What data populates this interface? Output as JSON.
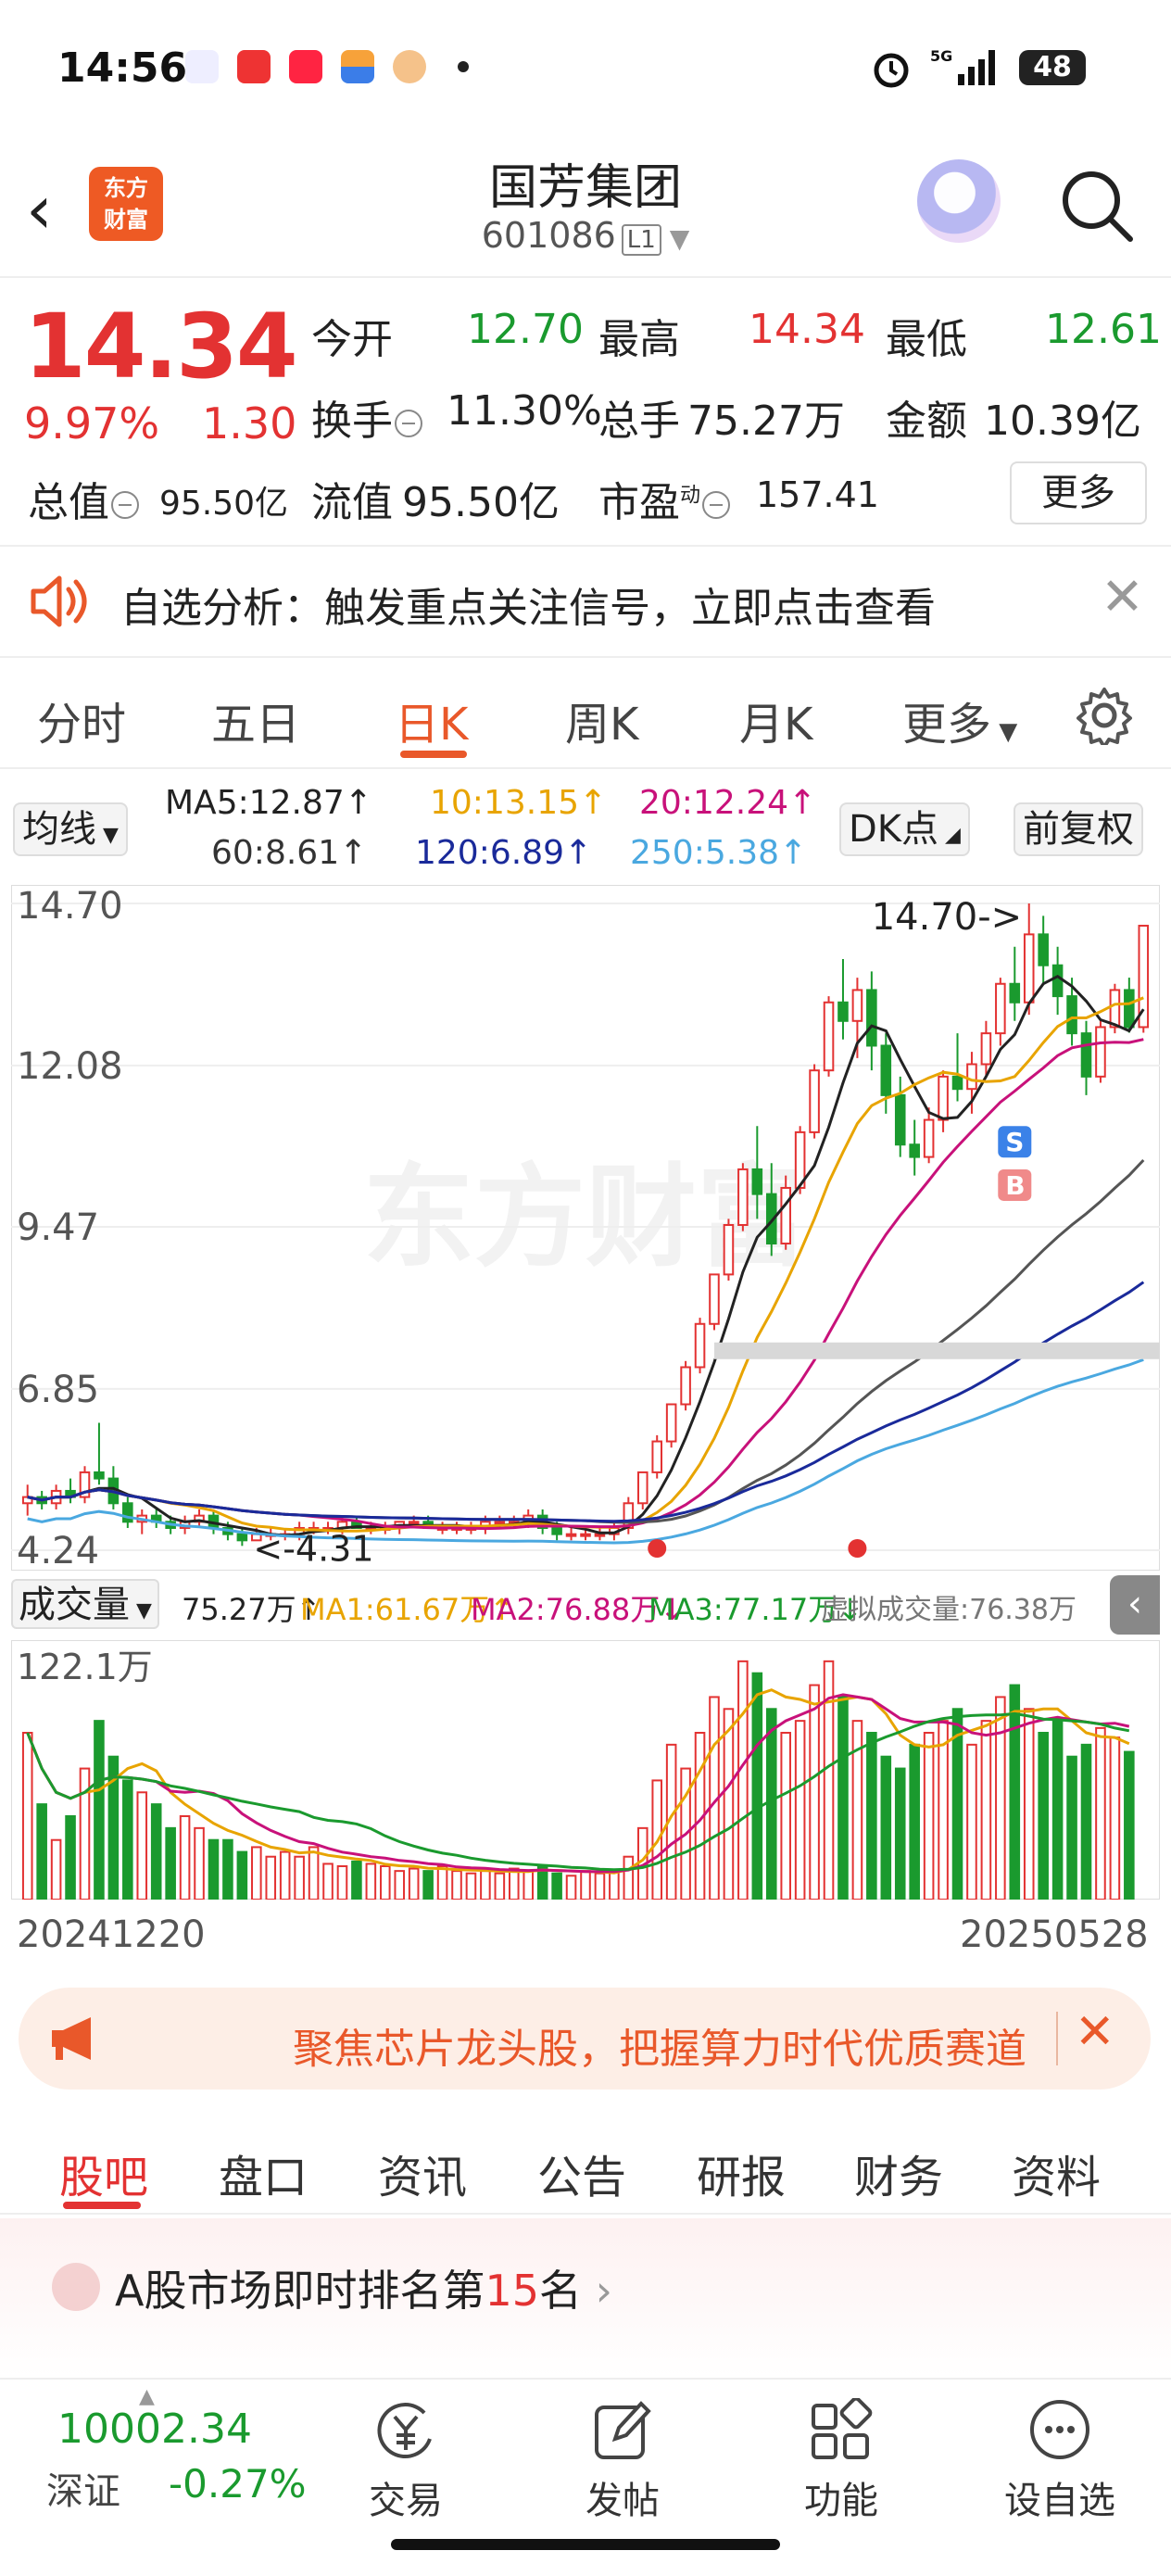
{
  "status": {
    "time": "14:56",
    "battery": "48"
  },
  "header": {
    "title": "国芳集团",
    "code": "601086",
    "level": "L1",
    "brand_line1": "东方",
    "brand_line2": "财富"
  },
  "quote": {
    "price": "14.34",
    "pct": "9.97%",
    "change": "1.30",
    "open_label": "今开",
    "open": "12.70",
    "high_label": "最高",
    "high": "14.34",
    "low_label": "最低",
    "low": "12.61",
    "turnover_label": "换手",
    "turnover": "11.30%",
    "volume_label": "总手",
    "volume": "75.27万",
    "amount_label": "金额",
    "amount": "10.39亿",
    "mktcap_label": "总值",
    "mktcap": "95.50亿",
    "float_label": "流值",
    "float_cap": "95.50亿",
    "pe_label": "市盈",
    "pe_sup": "动",
    "pe": "157.41",
    "more": "更多"
  },
  "alert": {
    "text": "自选分析：触发重点关注信号，立即点击查看"
  },
  "ktabs": [
    "分时",
    "五日",
    "日K",
    "周K",
    "月K",
    "更多"
  ],
  "ma_legend": {
    "selector": "均线",
    "ma5": "MA5:12.87↑",
    "ma10": "10:13.15↑",
    "ma20": "20:12.24↑",
    "ma60": "60:8.61↑",
    "ma120": "120:6.89↑",
    "ma250": "250:5.38↑",
    "dk": "DK点",
    "adjust": "前复权",
    "colors": {
      "ma5": "#222222",
      "ma10": "#e8a400",
      "ma20": "#c8117a",
      "ma60": "#555555",
      "ma120": "#1a2a9a",
      "ma250": "#4aa8e0"
    }
  },
  "chart_data": [
    {
      "type": "candlestick",
      "ylim": [
        4.24,
        14.7
      ],
      "yticks": [
        "14.70",
        "12.08",
        "9.47",
        "6.85",
        "4.24"
      ],
      "x_start": "20241220",
      "x_end": "20250528",
      "max_annotation": "14.70->",
      "min_annotation": "<-4.31",
      "watermark": "东方财富",
      "signals": [
        "S",
        "B"
      ],
      "candles": [
        [
          5.0,
          5.3,
          4.8,
          5.1
        ],
        [
          5.1,
          5.2,
          4.9,
          5.0
        ],
        [
          5.0,
          5.3,
          4.9,
          5.2
        ],
        [
          5.2,
          5.4,
          5.0,
          5.1
        ],
        [
          5.1,
          5.6,
          5.0,
          5.5
        ],
        [
          5.5,
          6.3,
          5.3,
          5.4
        ],
        [
          5.4,
          5.6,
          4.9,
          5.0
        ],
        [
          5.0,
          5.1,
          4.6,
          4.7
        ],
        [
          4.7,
          4.9,
          4.5,
          4.8
        ],
        [
          4.8,
          4.9,
          4.6,
          4.7
        ],
        [
          4.7,
          4.8,
          4.5,
          4.6
        ],
        [
          4.6,
          4.8,
          4.5,
          4.7
        ],
        [
          4.7,
          4.9,
          4.6,
          4.8
        ],
        [
          4.8,
          4.9,
          4.5,
          4.6
        ],
        [
          4.6,
          4.7,
          4.4,
          4.5
        ],
        [
          4.5,
          4.6,
          4.31,
          4.4
        ],
        [
          4.4,
          4.6,
          4.4,
          4.5
        ],
        [
          4.5,
          4.6,
          4.4,
          4.5
        ],
        [
          4.5,
          4.6,
          4.4,
          4.5
        ],
        [
          4.5,
          4.7,
          4.4,
          4.6
        ],
        [
          4.6,
          4.7,
          4.5,
          4.6
        ],
        [
          4.6,
          4.7,
          4.5,
          4.6
        ],
        [
          4.6,
          4.8,
          4.5,
          4.7
        ],
        [
          4.7,
          4.8,
          4.6,
          4.6
        ],
        [
          4.6,
          4.7,
          4.5,
          4.6
        ],
        [
          4.6,
          4.7,
          4.5,
          4.6
        ],
        [
          4.6,
          4.7,
          4.5,
          4.7
        ],
        [
          4.7,
          4.8,
          4.6,
          4.7
        ],
        [
          4.7,
          4.8,
          4.6,
          4.6
        ],
        [
          4.6,
          4.7,
          4.5,
          4.6
        ],
        [
          4.6,
          4.7,
          4.5,
          4.6
        ],
        [
          4.6,
          4.7,
          4.5,
          4.6
        ],
        [
          4.6,
          4.8,
          4.5,
          4.7
        ],
        [
          4.7,
          4.8,
          4.6,
          4.7
        ],
        [
          4.7,
          4.8,
          4.6,
          4.7
        ],
        [
          4.7,
          4.9,
          4.6,
          4.8
        ],
        [
          4.8,
          4.9,
          4.5,
          4.6
        ],
        [
          4.6,
          4.7,
          4.4,
          4.5
        ],
        [
          4.5,
          4.6,
          4.4,
          4.5
        ],
        [
          4.5,
          4.6,
          4.4,
          4.5
        ],
        [
          4.5,
          4.6,
          4.4,
          4.5
        ],
        [
          4.5,
          4.7,
          4.4,
          4.6
        ],
        [
          4.6,
          5.1,
          4.5,
          5.0
        ],
        [
          5.0,
          5.5,
          4.9,
          5.5
        ],
        [
          5.5,
          6.1,
          5.4,
          6.0
        ],
        [
          6.0,
          6.6,
          5.9,
          6.6
        ],
        [
          6.6,
          7.3,
          6.5,
          7.2
        ],
        [
          7.2,
          8.0,
          7.1,
          7.9
        ],
        [
          7.9,
          8.7,
          7.8,
          8.7
        ],
        [
          8.7,
          9.6,
          8.6,
          9.5
        ],
        [
          9.5,
          10.5,
          9.4,
          10.4
        ],
        [
          10.4,
          11.1,
          9.6,
          10.0
        ],
        [
          10.0,
          10.5,
          9.0,
          9.2
        ],
        [
          9.2,
          10.3,
          9.1,
          10.1
        ],
        [
          10.1,
          11.1,
          10.0,
          11.0
        ],
        [
          11.0,
          12.1,
          10.9,
          12.0
        ],
        [
          12.0,
          13.2,
          11.9,
          13.1
        ],
        [
          13.1,
          13.8,
          12.5,
          12.8
        ],
        [
          12.8,
          13.5,
          12.2,
          13.3
        ],
        [
          13.3,
          13.6,
          12.0,
          12.4
        ],
        [
          12.4,
          12.6,
          11.3,
          11.6
        ],
        [
          11.6,
          11.9,
          10.6,
          10.8
        ],
        [
          10.8,
          11.2,
          10.3,
          10.6
        ],
        [
          10.6,
          11.4,
          10.5,
          11.2
        ],
        [
          11.2,
          12.0,
          11.0,
          11.9
        ],
        [
          11.9,
          12.6,
          11.5,
          11.7
        ],
        [
          11.7,
          12.3,
          11.3,
          12.1
        ],
        [
          12.1,
          12.8,
          11.9,
          12.6
        ],
        [
          12.6,
          13.5,
          12.4,
          13.4
        ],
        [
          13.4,
          14.0,
          12.8,
          13.1
        ],
        [
          13.1,
          14.7,
          12.9,
          14.2
        ],
        [
          14.2,
          14.5,
          13.4,
          13.7
        ],
        [
          13.7,
          14.0,
          12.9,
          13.2
        ],
        [
          13.2,
          13.5,
          12.4,
          12.6
        ],
        [
          12.6,
          12.8,
          11.6,
          11.9
        ],
        [
          11.9,
          12.8,
          11.8,
          12.7
        ],
        [
          12.7,
          13.4,
          12.6,
          13.3
        ],
        [
          13.3,
          13.5,
          12.61,
          12.7
        ],
        [
          12.7,
          14.34,
          12.61,
          14.34
        ]
      ]
    },
    {
      "type": "bar",
      "title": "成交量",
      "ylabel_top": "122.1万",
      "legend": {
        "vol": "75.27万↑",
        "ma1": "MA1:61.67万↑",
        "ma2": "MA2:76.88万↓",
        "ma3": "MA3:77.17万↓",
        "virtual": "虚拟成交量:76.38万"
      },
      "values": [
        70,
        40,
        25,
        35,
        55,
        75,
        60,
        50,
        45,
        40,
        30,
        35,
        30,
        25,
        25,
        20,
        22,
        18,
        20,
        18,
        22,
        15,
        14,
        16,
        15,
        14,
        12,
        13,
        12,
        14,
        12,
        11,
        12,
        11,
        13,
        12,
        14,
        11,
        10,
        12,
        11,
        12,
        18,
        30,
        50,
        65,
        55,
        70,
        85,
        80,
        100,
        95,
        80,
        70,
        75,
        90,
        100,
        85,
        75,
        70,
        60,
        55,
        65,
        70,
        75,
        80,
        65,
        75,
        85,
        90,
        80,
        70,
        75,
        60,
        65,
        72,
        68,
        62
      ]
    }
  ],
  "banner": {
    "text": "聚焦芯片龙头股，把握算力时代优质赛道"
  },
  "ntabs": [
    "股吧",
    "盘口",
    "资讯",
    "公告",
    "研报",
    "财务",
    "资料"
  ],
  "rank": {
    "prefix": "A股市场即时排名第",
    "rank": "15",
    "suffix": "名"
  },
  "bottom": {
    "index_value": "10002.34",
    "index_name": "深证",
    "index_pct": "-0.27%",
    "buttons": [
      "交易",
      "发帖",
      "功能",
      "设自选"
    ]
  }
}
